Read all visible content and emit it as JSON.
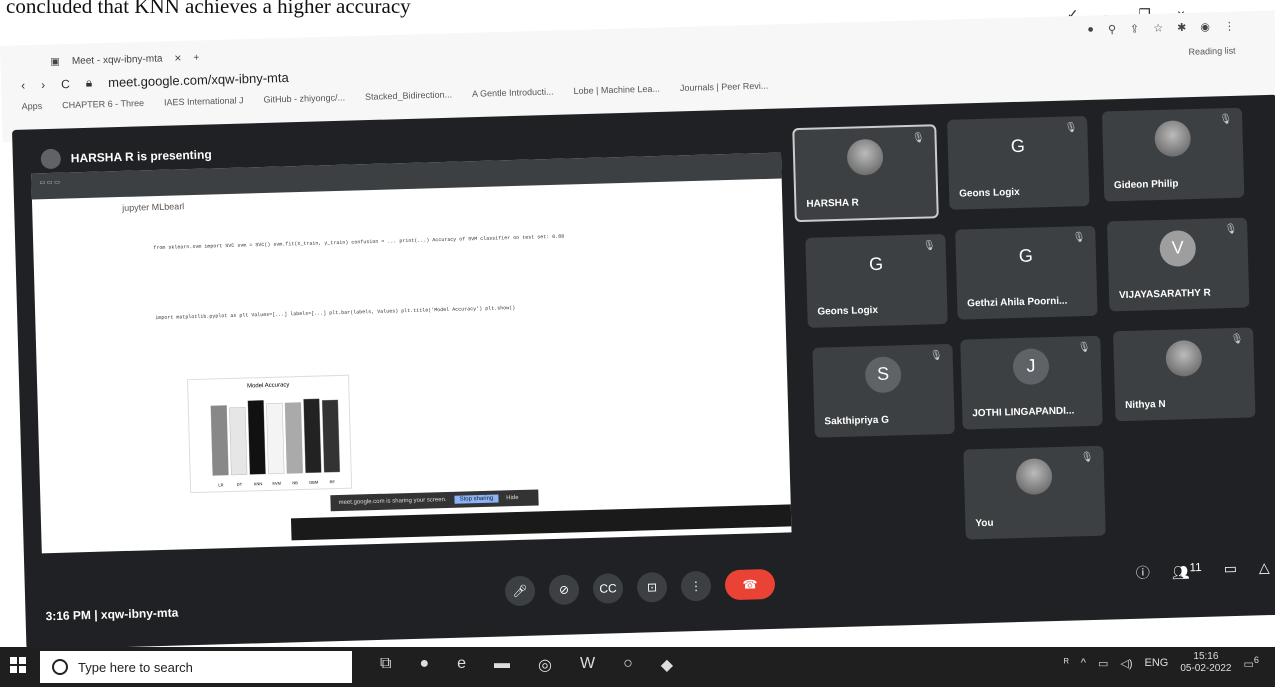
{
  "paper": {
    "text": "concluded that KNN achieves a higher accuracy"
  },
  "window_controls": [
    "✓",
    "–",
    "❐",
    "×"
  ],
  "browser": {
    "tab_title": "Meet - xqw-ibny-mta",
    "url": "meet.google.com/xqw-ibny-mta",
    "bookmarks": [
      "Apps",
      "CHAPTER 6 - Three",
      "IAES International J",
      "GitHub - zhiyongc/...",
      "Stacked_Bidirection...",
      "A Gentle Introducti...",
      "Lobe | Machine Lea...",
      "Journals | Peer Revi..."
    ],
    "reading_list": "Reading list"
  },
  "meet": {
    "presenting": "HARSHA R is presenting",
    "jupyter_title": "jupyter MLbearl",
    "code1": "from sklearn.svm import SVC\n\nsvm = SVC()\nsvm.fit(X_train, y_train)\nconfusion = ...\nprint(...)\nAccuracy of SVM classifier on test set: 0.88",
    "code2": "import matplotlib.pyplot as plt\nValues=[...]\nlabels=[...]\nplt.bar(labels, Values)\nplt.title('Model Accuracy')\nplt.show()",
    "chart_title": "Model Accuracy",
    "share_text": "meet.google.com is sharing your screen.",
    "stop_sharing": "Stop sharing",
    "hide": "Hide",
    "participants": [
      {
        "name": "HARSHA R",
        "initial": "",
        "photo": true,
        "color": "#5f6368"
      },
      {
        "name": "Geons Logix",
        "initial": "G",
        "photo": false,
        "color": "#3c4043"
      },
      {
        "name": "Gideon Philip",
        "initial": "",
        "photo": true,
        "color": "#5f6368"
      },
      {
        "name": "Geons Logix",
        "initial": "G",
        "photo": false,
        "color": "#3c4043"
      },
      {
        "name": "Gethzi Ahila Poorni...",
        "initial": "G",
        "photo": false,
        "color": "#3c4043"
      },
      {
        "name": "VIJAYASARATHY R",
        "initial": "V",
        "photo": false,
        "color": "#9e9e9e"
      },
      {
        "name": "Sakthipriya G",
        "initial": "S",
        "photo": false,
        "color": "#5f6368"
      },
      {
        "name": "JOTHI LINGAPANDI...",
        "initial": "J",
        "photo": false,
        "color": "#5f6368"
      },
      {
        "name": "Nithya N",
        "initial": "",
        "photo": true,
        "color": "#5f6368"
      },
      {
        "name": "You",
        "initial": "",
        "photo": true,
        "color": "#5f6368"
      }
    ],
    "time_meeting": "3:16 PM  |  xqw-ibny-mta",
    "participant_count": "11"
  },
  "taskbar": {
    "search_placeholder": "Type here to search",
    "tray_lang": "ENG",
    "clock_time": "15:16",
    "clock_date": "05-02-2022",
    "notif_count": "6"
  },
  "chart_data": {
    "type": "bar",
    "title": "Model Accuracy",
    "categories": [
      "LR",
      "DT",
      "KNN",
      "SVM",
      "NB",
      "GBM",
      "RF"
    ],
    "values": [
      0.85,
      0.82,
      0.9,
      0.86,
      0.86,
      0.9,
      0.88
    ],
    "colors": [
      "#888888",
      "#e6e6e6",
      "#111111",
      "#f4f4f4",
      "#aaaaaa",
      "#222222",
      "#333333"
    ],
    "ylim": [
      0,
      1.0
    ]
  }
}
